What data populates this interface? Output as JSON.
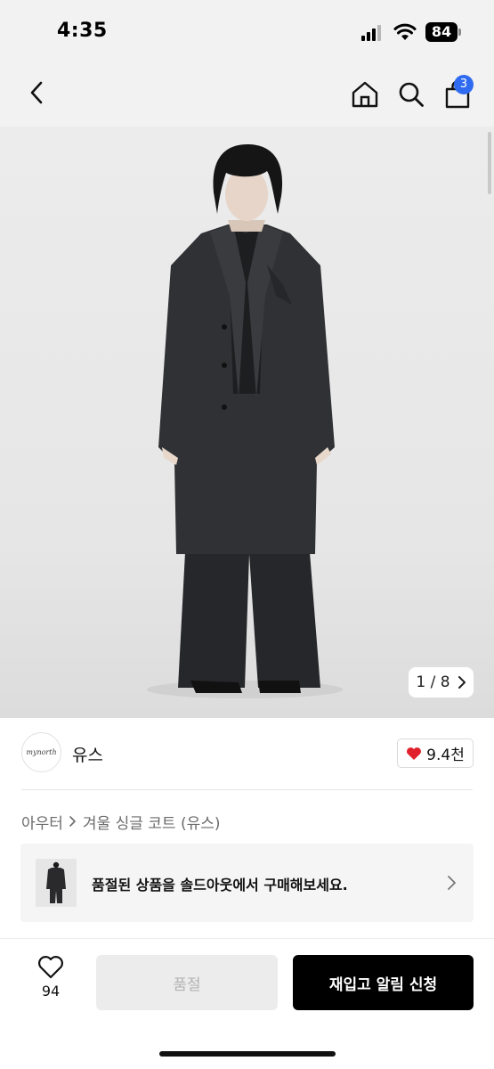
{
  "status_bar": {
    "time": "4:35",
    "battery": "84",
    "icons": [
      "signal-icon",
      "wifi-icon",
      "battery-icon"
    ]
  },
  "nav": {
    "icons": [
      "chevron-left-icon",
      "home-icon",
      "search-icon",
      "shopping-bag-icon"
    ],
    "cart_badge": "3",
    "badge_color": "#2f6bf0"
  },
  "gallery": {
    "counter_current": "1",
    "counter_separator": "/",
    "counter_total": "8"
  },
  "brand": {
    "name": "유스",
    "logo_text": "mynorth",
    "likes": "9.4천",
    "heart_color": "#e0202a"
  },
  "breadcrumb": {
    "category": "아우터",
    "product": "겨울 싱글 코트 (유스)"
  },
  "banner": {
    "text": "품절된 상품을 솔드아웃에서 구매해보세요."
  },
  "bottom_bar": {
    "wish_count": "94",
    "soldout_label": "품절",
    "restock_label": "재입고 알림 신청"
  }
}
